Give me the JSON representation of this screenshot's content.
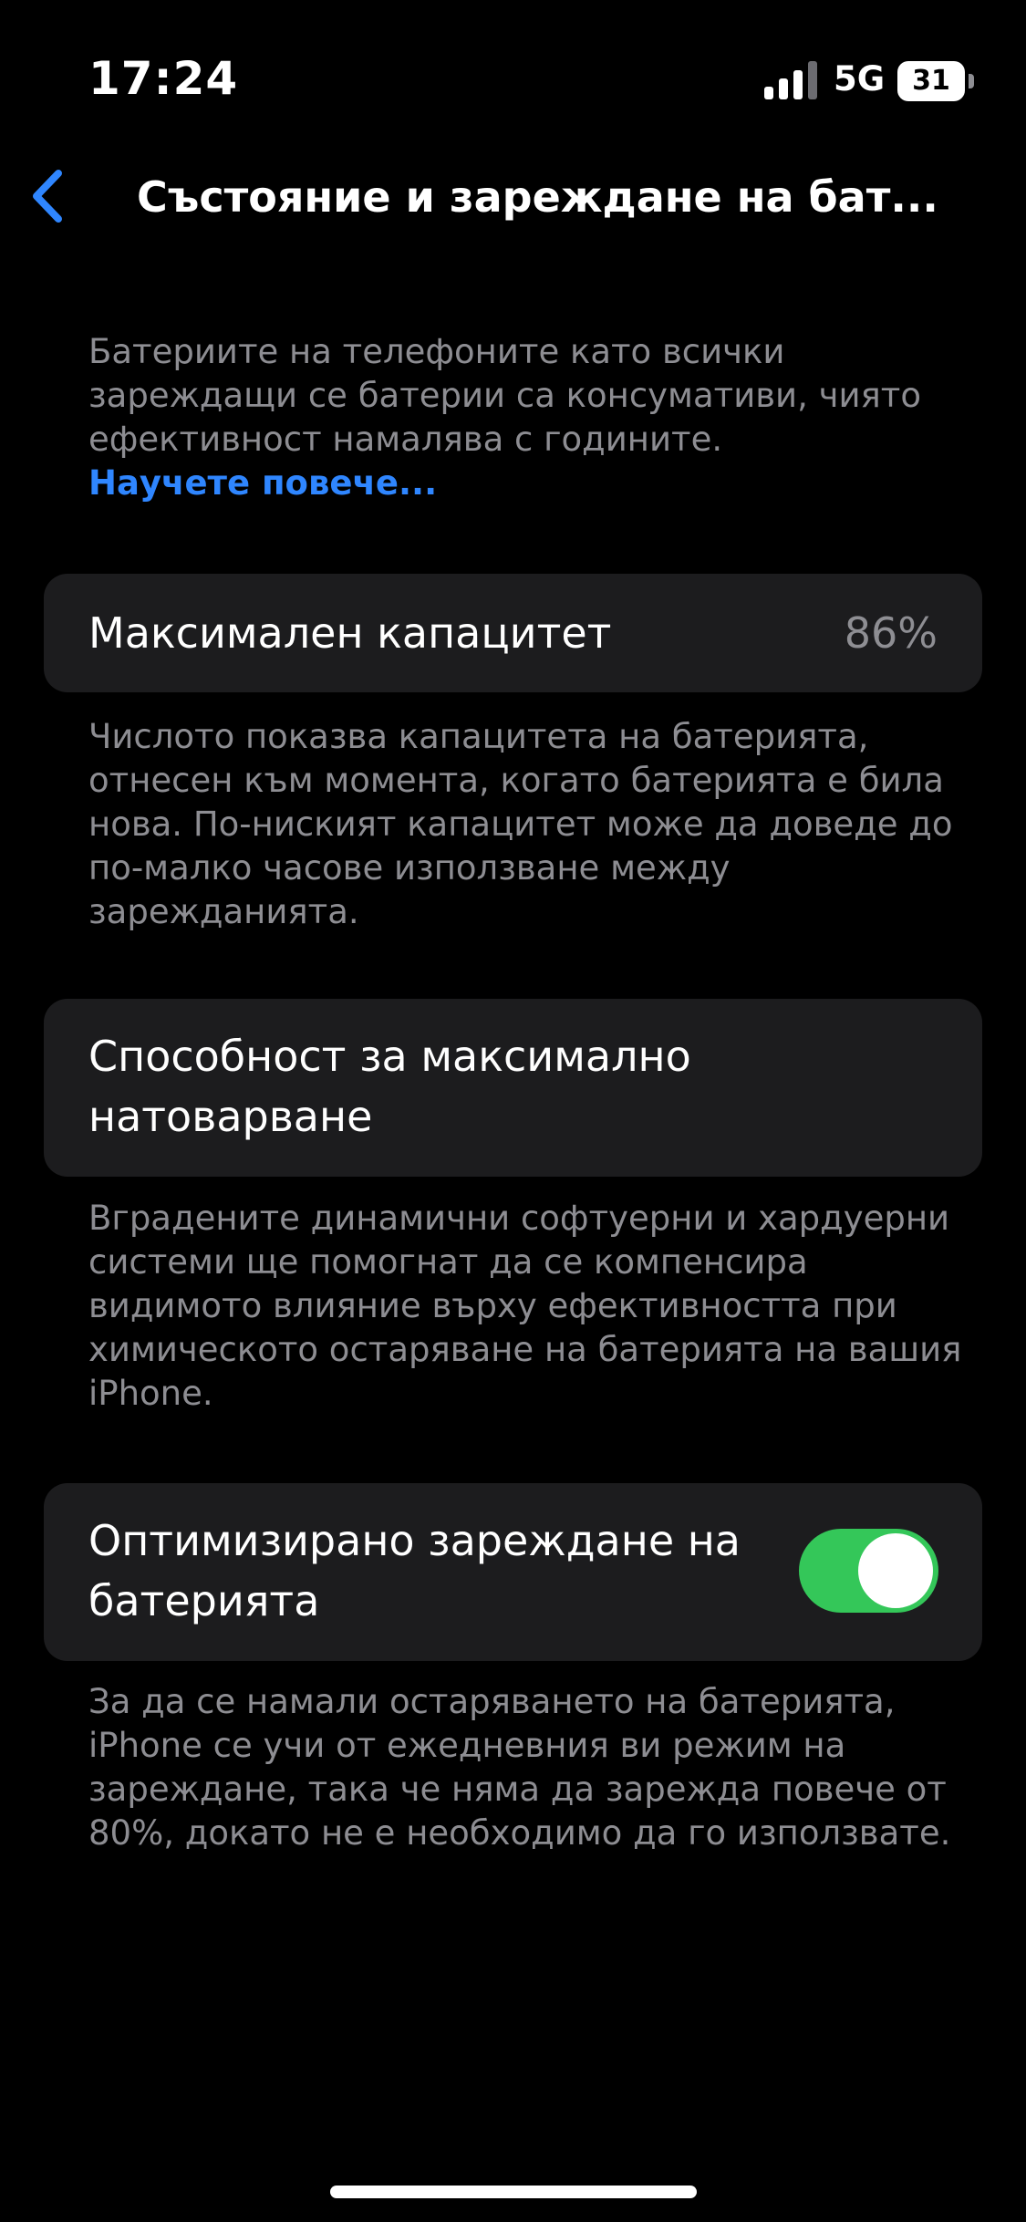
{
  "status_bar": {
    "time": "17:24",
    "network": "5G",
    "battery_level": "31",
    "icons": [
      "signal-icon",
      "battery-icon"
    ]
  },
  "nav": {
    "back_icon": "chevron-left-icon",
    "title": "Състояние и зареждане на бат..."
  },
  "intro": {
    "text": "Батериите на телефоните като всички зареждащи се батерии са консумативи, чиято ефективност намалява с годините.",
    "link": "Научете повече..."
  },
  "max_capacity": {
    "label": "Максимален капацитет",
    "value": "86%",
    "footnote": "Числото показва капацитета на батерията, отнесен към момента, когато батерията е била нова. По-ниският капацитет може да доведе до по-малко часове използване между зарежданията."
  },
  "peak_performance": {
    "label": "Способност за максимално натоварване",
    "footnote": "Вградените динамични софтуерни и хардуерни системи ще помогнат да се компенсира видимото влияние върху ефективността при химическото остаряване на батерията на вашия iPhone."
  },
  "optimized_charging": {
    "label": "Оптимизирано зареждане на батерията",
    "enabled": true,
    "footnote": "За да се намали остаряването на батерията, iPhone се учи от ежедневния ви режим на зареждане, така че няма да зарежда повече от 80%, докато не е необходимо да го използвате."
  },
  "colors": {
    "background": "#000000",
    "card": "#1c1c1e",
    "accent_blue": "#2f86ff",
    "toggle_on": "#34c759",
    "secondary_text": "#8d8d92"
  }
}
